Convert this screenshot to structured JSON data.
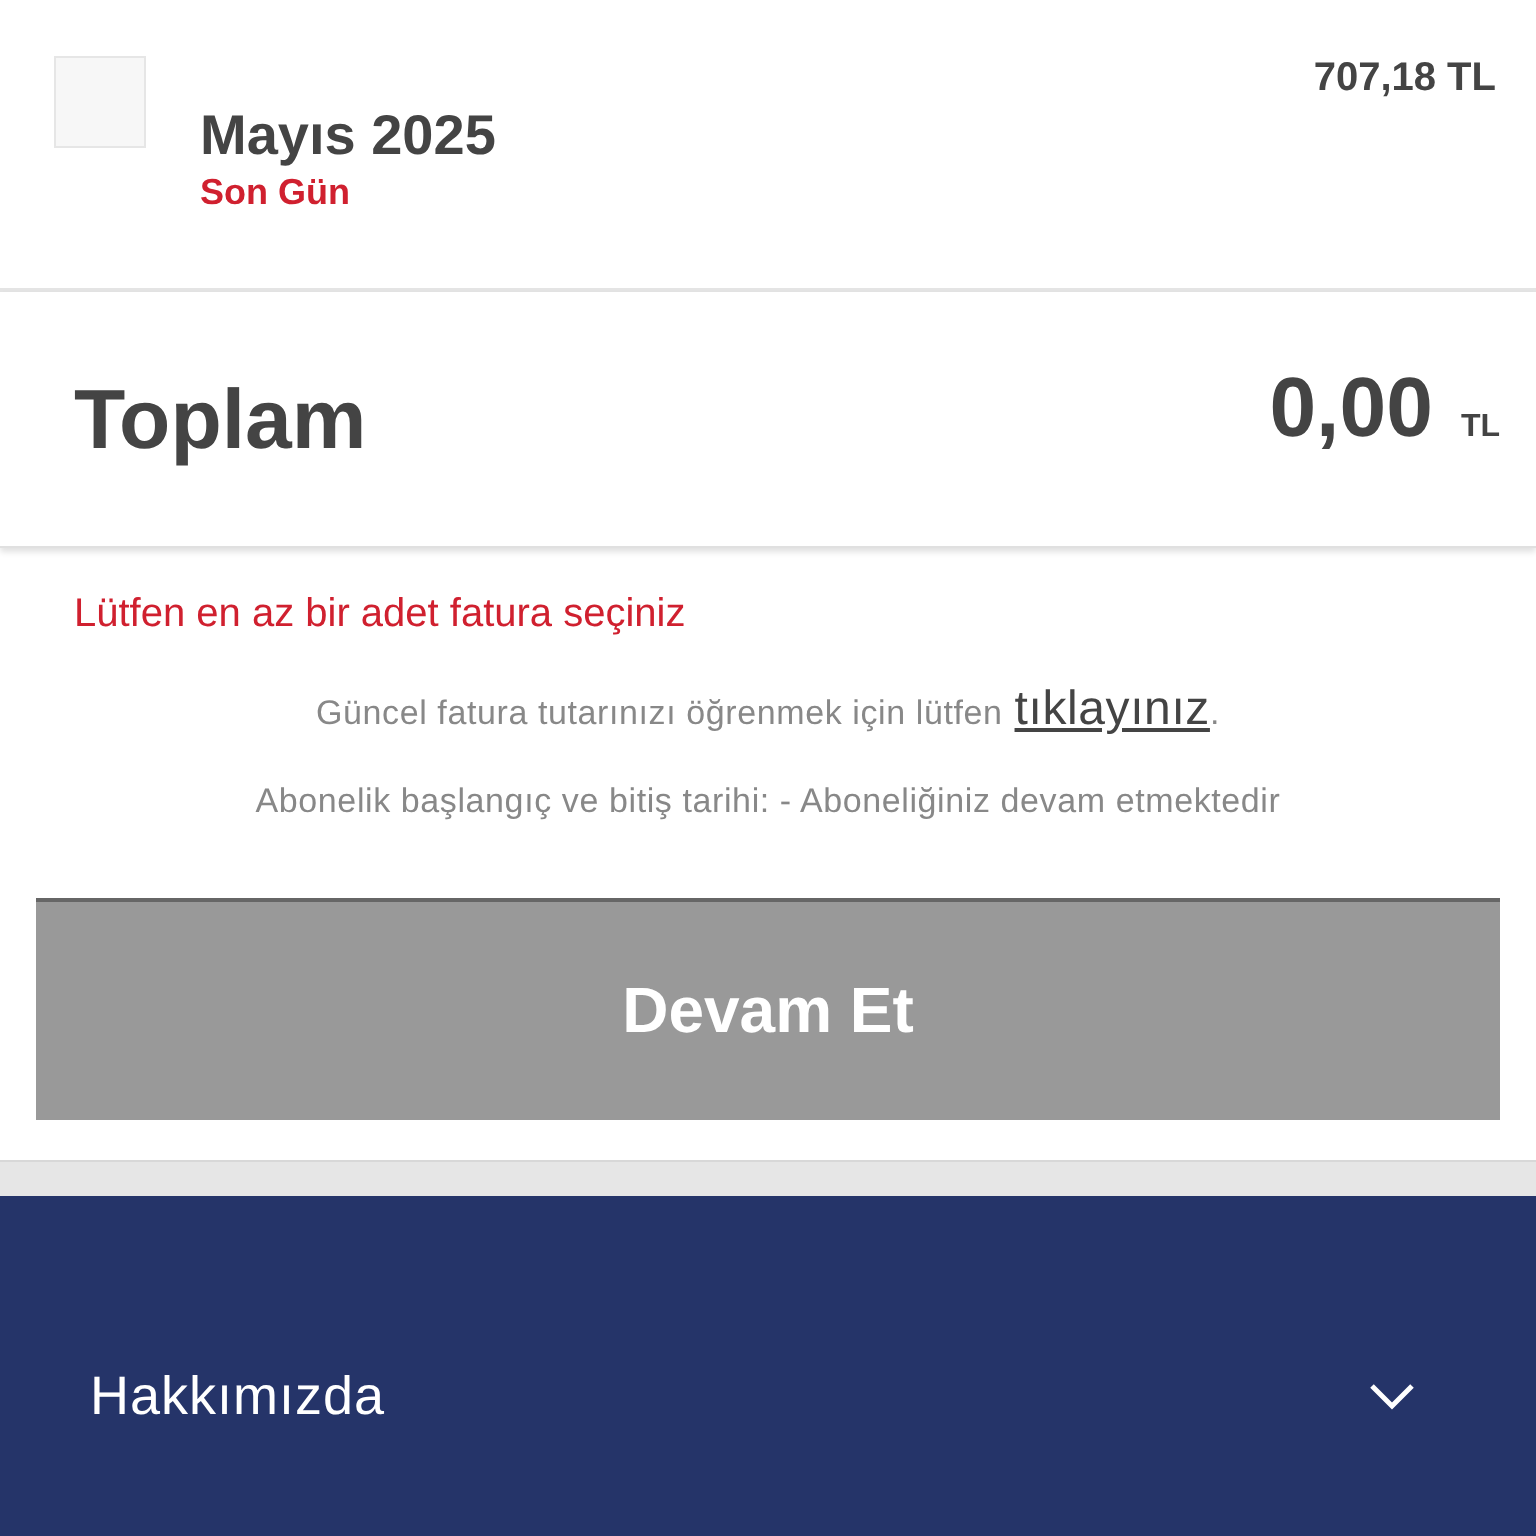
{
  "invoice": {
    "checked": false,
    "title": "Mayıs 2025",
    "due_label": "Son Gün",
    "amount": "707,18 TL"
  },
  "total": {
    "label": "Toplam",
    "amount": "0,00",
    "currency": "TL"
  },
  "error": "Lütfen en az bir adet fatura seçiniz",
  "info": {
    "text": "Güncel fatura tutarınızı öğrenmek için lütfen",
    "link": "tıklayınız",
    "end": "."
  },
  "subscription": "Abonelik başlangıç ve bitiş tarihi: - Aboneliğiniz devam etmektedir",
  "continue_button": {
    "label": "Devam Et",
    "disabled": true
  },
  "footer": {
    "sections": [
      {
        "label": "Hakkımızda",
        "expanded": false
      }
    ]
  }
}
